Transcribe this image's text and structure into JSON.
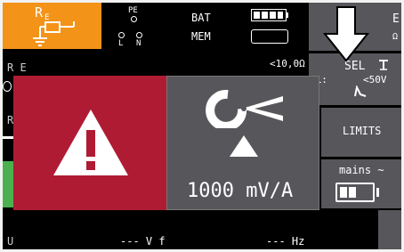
{
  "header": {
    "mode_main": "R",
    "mode_sub": "E",
    "conn_pe": "PE",
    "conn_l": "L",
    "conn_n": "N",
    "bat_label": "BAT",
    "mem_label": "MEM"
  },
  "softkeys": {
    "top_partial": "E",
    "top_partial_unit": "Ω",
    "sel_label": "SEL",
    "limits_label": "LIMITS",
    "mains_label": "mains ~"
  },
  "measurement": {
    "left_label_1": "R E",
    "left_label_2": "R",
    "limit_value": "<10,0Ω",
    "ul_label": "UL:",
    "ul_value": "<50V",
    "bottom_u": "U",
    "bottom_voltage": "--- V f",
    "bottom_freq": "--- Hz"
  },
  "warning": {
    "clamp_ratio": "1000 mV/A"
  },
  "colors": {
    "mode_orange": "#f39317",
    "warning_red": "#b01b34",
    "panel_gray": "#56565b",
    "status_green": "#4caf50"
  }
}
